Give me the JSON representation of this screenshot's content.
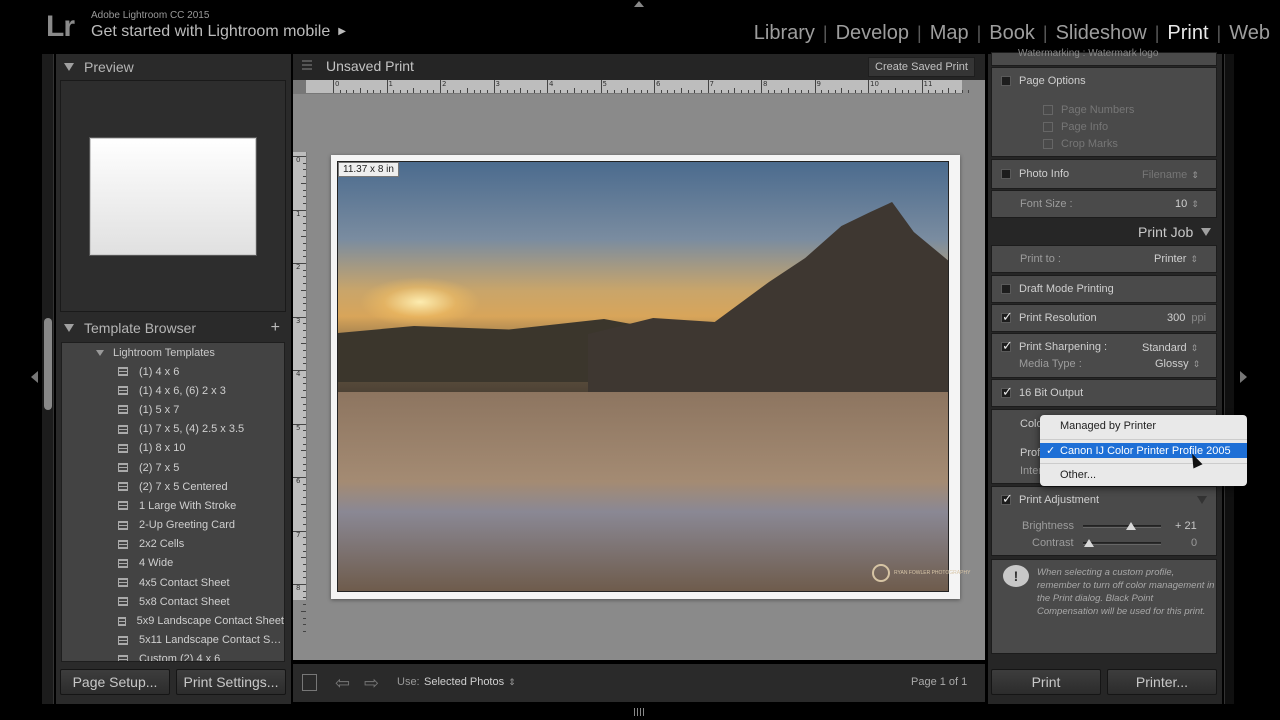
{
  "topbar": {
    "logo": "Lr",
    "app_title": "Adobe Lightroom CC 2015",
    "mobile_link": "Get started with Lightroom mobile",
    "mobile_arrow": "▶",
    "modules": [
      {
        "label": "Library",
        "active": false
      },
      {
        "label": "Develop",
        "active": false
      },
      {
        "label": "Map",
        "active": false
      },
      {
        "label": "Book",
        "active": false
      },
      {
        "label": "Slideshow",
        "active": false
      },
      {
        "label": "Print",
        "active": true
      },
      {
        "label": "Web",
        "active": false
      }
    ],
    "separator": "|"
  },
  "left_panel": {
    "preview_header": "Preview",
    "template_browser_header": "Template Browser",
    "add_icon": "+",
    "folder": "Lightroom Templates",
    "templates": [
      "(1) 4 x 6",
      "(1) 4 x 6, (6) 2 x 3",
      "(1) 5 x 7",
      "(1) 7 x 5, (4) 2.5 x 3.5",
      "(1) 8 x 10",
      "(2) 7 x 5",
      "(2) 7 x 5 Centered",
      "1 Large With Stroke",
      "2-Up Greeting Card",
      "2x2 Cells",
      "4 Wide",
      "4x5 Contact Sheet",
      "5x8 Contact Sheet",
      "5x9 Landscape Contact Sheet",
      "5x11 Landscape Contact S…",
      "Custom (2) 4 x 6"
    ],
    "page_setup_button": "Page Setup...",
    "print_settings_button": "Print Settings..."
  },
  "center": {
    "title": "Unsaved Print",
    "create_saved_button": "Create Saved Print",
    "ruler_top": [
      "0",
      "1",
      "2",
      "3",
      "4",
      "5",
      "6",
      "7",
      "8",
      "9",
      "10",
      "11"
    ],
    "ruler_left": [
      "0",
      "1",
      "2",
      "3",
      "4",
      "5",
      "6",
      "7",
      "8"
    ],
    "dimension_label": "11.37 x 8 in",
    "watermark": "RYAN FOWLER PHOTOGRAPHY",
    "footer": {
      "use_label": "Use:",
      "use_value": "Selected Photos",
      "stepper": "⇕",
      "page_count": "Page 1 of 1"
    }
  },
  "right_panel": {
    "watermark_row": "Watermarking : Watermark logo",
    "page_options": {
      "label": "Page Options",
      "checked": false,
      "sub": [
        {
          "label": "Page Numbers",
          "checked": false
        },
        {
          "label": "Page Info",
          "checked": false
        },
        {
          "label": "Crop Marks",
          "checked": false
        }
      ]
    },
    "photo_info": {
      "label": "Photo Info",
      "value": "Filename",
      "checked": false
    },
    "font_size": {
      "label": "Font Size :",
      "value": "10"
    },
    "print_job_header": "Print Job",
    "print_to": {
      "label": "Print to :",
      "value": "Printer"
    },
    "draft_mode": {
      "label": "Draft Mode Printing",
      "checked": false
    },
    "print_resolution": {
      "label": "Print Resolution",
      "value": "300",
      "unit": "ppi",
      "checked": true
    },
    "print_sharpening": {
      "label": "Print Sharpening :",
      "value": "Standard",
      "checked": true
    },
    "media_type": {
      "label": "Media Type :",
      "value": "Glossy"
    },
    "bit_output": {
      "label": "16 Bit Output",
      "checked": true
    },
    "color_mgmt_label": "Color Management",
    "profile_label": "Profile :",
    "intent_label": "Intent :",
    "print_adjustment": {
      "label": "Print Adjustment",
      "checked": true
    },
    "brightness": {
      "label": "Brightness",
      "value": "+ 21",
      "level": 0.62
    },
    "contrast": {
      "label": "Contrast",
      "value": "0",
      "level": 0.08
    },
    "info_text": "When selecting a custom profile, remember to turn off color management in the Print dialog. Black Point Compensation will be used for this print.",
    "print_button": "Print",
    "printer_button": "Printer..."
  },
  "profile_dropdown": {
    "items": [
      {
        "label": "Managed by Printer",
        "selected": false
      },
      {
        "label": "Canon IJ Color Printer Profile 2005",
        "selected": true
      },
      {
        "label": "Other...",
        "selected": false
      }
    ],
    "check": "✓"
  }
}
